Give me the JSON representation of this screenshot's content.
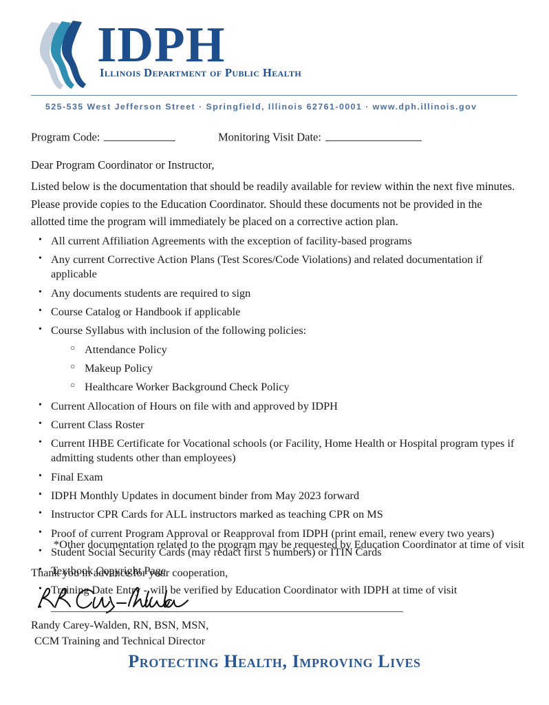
{
  "letterhead": {
    "wordmark": "IDPH",
    "wordmark_subtitle": "Illinois Department of Public Health",
    "address_line": "525-535 West Jefferson Street  ·  Springfield, Illinois 62761-0001  ·  www.dph.illinois.gov",
    "brand_color": "#1e4d8c",
    "rule_color": "#5f7fa8",
    "address_color": "#4a6fa0",
    "logo_colors": {
      "light": "#c3cedd",
      "medium": "#2f8fb3",
      "dark": "#1d4e87"
    }
  },
  "form": {
    "program_code_label": "Program Code:",
    "program_code_value": "",
    "visit_date_label": "Monitoring Visit Date:",
    "visit_date_value": ""
  },
  "body": {
    "salutation": "Dear Program Coordinator or Instructor,",
    "intro": "Listed below is the documentation that should be readily available for review within the next five minutes. Please provide copies to the Education Coordinator. Should these documents not be provided in the allotted time the program will immediately be placed on a corrective action plan.",
    "footnote": "*Other documentation related to the program may be requested by Education Coordinator at time of visit",
    "thanks": "Thank you in advance for your cooperation,"
  },
  "list": {
    "bullet_marker": "•",
    "sub_marker": "○",
    "items": [
      {
        "text": "All current Affiliation Agreements with the exception of facility-based programs",
        "level": 1
      },
      {
        "text": "Any current Corrective Action Plans (Test Scores/Code Violations) and related documentation if applicable",
        "level": 1
      },
      {
        "text": "Any documents students are required to sign",
        "level": 1
      },
      {
        "text": "Course Catalog or Handbook if applicable",
        "level": 1
      },
      {
        "text": "Course Syllabus with inclusion of the following policies:",
        "level": 1
      },
      {
        "text": "Attendance Policy",
        "level": 2
      },
      {
        "text": "Makeup Policy",
        "level": 2
      },
      {
        "text": "Healthcare Worker Background Check Policy",
        "level": 2
      },
      {
        "text": "Current Allocation of Hours on file with and approved by IDPH",
        "level": 1
      },
      {
        "text": "Current Class Roster",
        "level": 1
      },
      {
        "text": "Current IHBE Certificate for Vocational schools (or Facility, Home Health or Hospital program types if admitting students other than employees)",
        "level": 1
      },
      {
        "text": "Final Exam",
        "level": 1
      },
      {
        "text": "IDPH Monthly Updates in document binder from May 2023 forward",
        "level": 1
      },
      {
        "text": "Instructor CPR Cards for ALL instructors marked as teaching CPR on MS",
        "level": 1
      },
      {
        "text": "Proof of current Program Approval or Reapproval from IDPH (print email, renew every two years)",
        "level": 1
      },
      {
        "text": "Student Social Security Cards (may redact first 5 numbers) or ITIN Cards",
        "level": 1
      },
      {
        "text": "Textbook Copyright Page",
        "level": 1
      },
      {
        "text": "Training Date Entry - will be verified by Education Coordinator with IDPH at time of visit",
        "level": 1
      },
      {
        "text": "",
        "level": 1,
        "blank_line": true
      }
    ]
  },
  "signature": {
    "script_text": "R.R. Carey-Walden",
    "name": "Randy Carey-Walden, RN, BSN, MSN,",
    "title": "CCM Training and Technical Director"
  },
  "footer": {
    "tagline": "Protecting Health, Improving Lives",
    "color": "#2a5894"
  }
}
